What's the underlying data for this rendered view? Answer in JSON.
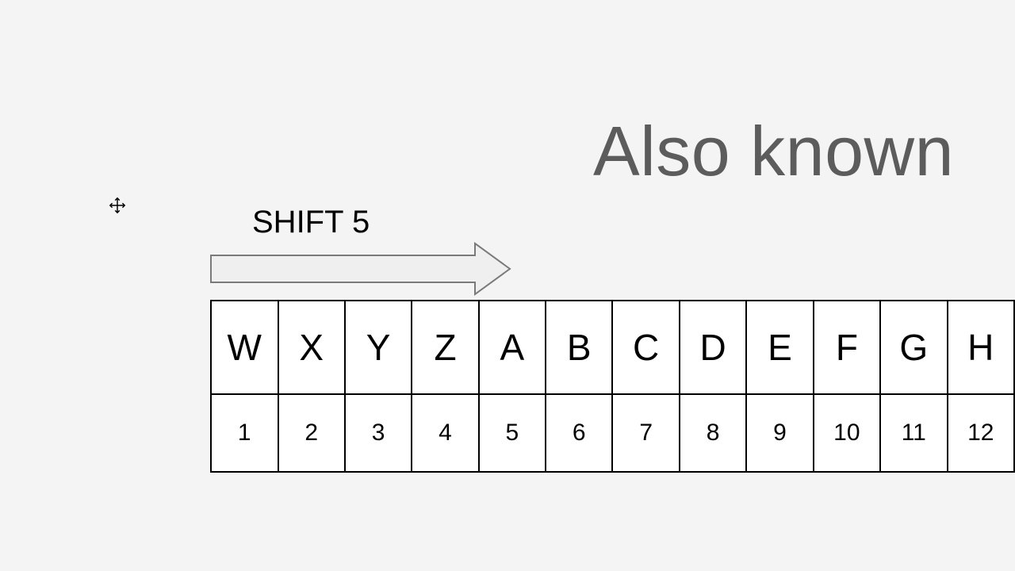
{
  "heading": "Also known",
  "shift_label": "SHIFT 5",
  "letters": [
    "W",
    "X",
    "Y",
    "Z",
    "A",
    "B",
    "C",
    "D",
    "E",
    "F",
    "G",
    "H"
  ],
  "numbers": [
    "1",
    "2",
    "3",
    "4",
    "5",
    "6",
    "7",
    "8",
    "9",
    "10",
    "11",
    "12"
  ],
  "cursor_glyph": "✥",
  "chart_data": {
    "type": "table",
    "title": "Caesar cipher shift table (shift 5)",
    "rows": [
      {
        "name": "ciphertext_letters",
        "values": [
          "W",
          "X",
          "Y",
          "Z",
          "A",
          "B",
          "C",
          "D",
          "E",
          "F",
          "G",
          "H"
        ]
      },
      {
        "name": "positions",
        "values": [
          1,
          2,
          3,
          4,
          5,
          6,
          7,
          8,
          9,
          10,
          11,
          12
        ]
      }
    ],
    "annotation": "SHIFT 5",
    "arrow_direction": "right"
  }
}
